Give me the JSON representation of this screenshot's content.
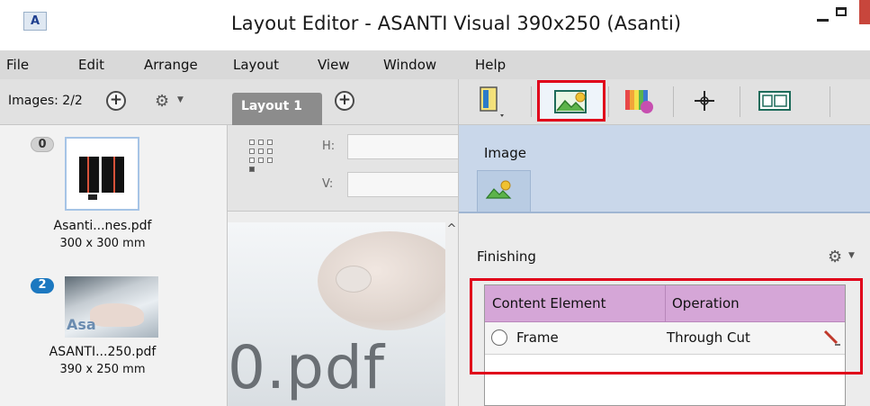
{
  "window": {
    "logo": "A",
    "title": "Layout Editor - ASANTI Visual 390x250 (Asanti)"
  },
  "menu": [
    "File",
    "Edit",
    "Arrange",
    "Layout",
    "View",
    "Window",
    "Help"
  ],
  "images_panel": {
    "count_label": "Images: 2/2",
    "add_symbol": "+",
    "items": [
      {
        "badge": "0",
        "name": "Asanti...nes.pdf",
        "size": "300 x 300 mm"
      },
      {
        "badge": "2",
        "name": "ASANTI...250.pdf",
        "size": "390 x 250 mm"
      }
    ]
  },
  "layout_tabs": {
    "active_tab": "Layout 1",
    "add_symbol": "+"
  },
  "position": {
    "h_label": "H:",
    "v_label": "V:",
    "h_value": "",
    "v_value": ""
  },
  "canvas": {
    "visible_text": "0.pdf",
    "scroll_up": "^"
  },
  "right_toolbar": {
    "tools": [
      "document-tool",
      "image-tool",
      "color-tool",
      "crosshair-tool",
      "frame-tool"
    ],
    "selected_tool": "image-tool"
  },
  "image_panel": {
    "title": "Image"
  },
  "finishing": {
    "title": "Finishing",
    "columns": [
      "Content Element",
      "Operation"
    ],
    "rows": [
      {
        "element": "Frame",
        "operation": "Through Cut"
      }
    ]
  },
  "colors": {
    "highlight": "#e0001a",
    "table_header": "#d5a6d7",
    "image_panel_bg": "#c9d7ea",
    "badge_selected": "#1c78c0"
  }
}
